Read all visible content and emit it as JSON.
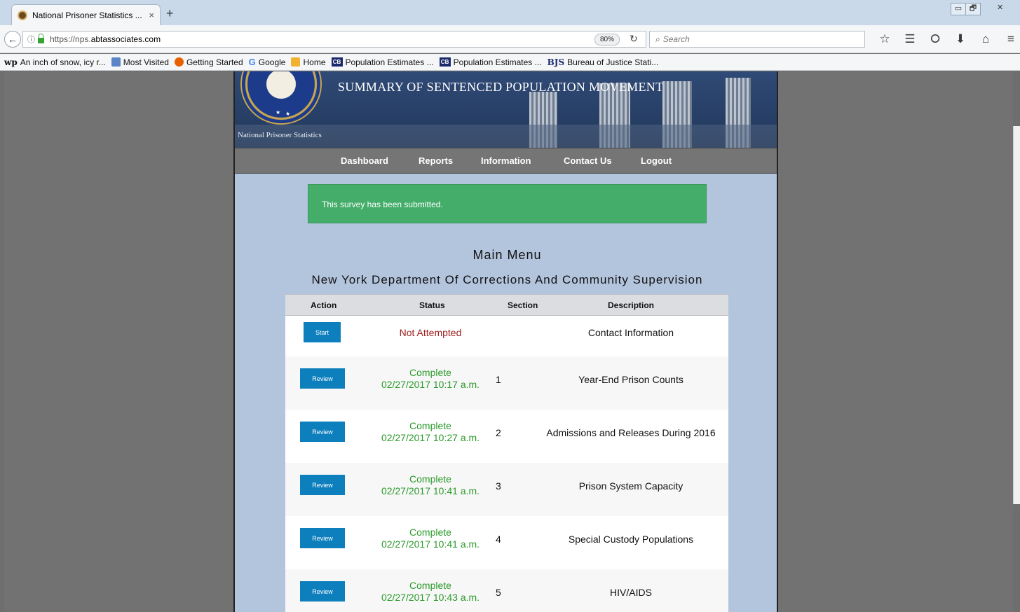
{
  "browser": {
    "tab_title": "National Prisoner Statistics ...",
    "tab_close": "×",
    "new_tab": "+",
    "url_prefix": "https://nps.",
    "url_host": "abtassociates.com",
    "zoom": "80%",
    "search_placeholder": "Search",
    "window_controls": [
      "▭",
      "🗗",
      "✕"
    ],
    "bookmarks": [
      {
        "icon": "washington-post-icon",
        "glyph": "wp",
        "label": "An inch of snow, icy r..."
      },
      {
        "icon": "most-visited-icon",
        "glyph": "",
        "label": "Most Visited"
      },
      {
        "icon": "firefox-icon",
        "glyph": "",
        "label": "Getting Started"
      },
      {
        "icon": "google-icon",
        "glyph": "G",
        "label": "Google"
      },
      {
        "icon": "home-icon",
        "glyph": "",
        "label": "Home"
      },
      {
        "icon": "census-icon",
        "glyph": "CB",
        "label": "Population Estimates ..."
      },
      {
        "icon": "census-icon",
        "glyph": "CB",
        "label": "Population Estimates ..."
      },
      {
        "icon": "bjs-icon",
        "glyph": "BJS",
        "label": "Bureau of Justice Stati..."
      }
    ]
  },
  "banner": {
    "title": "SUMMARY OF SENTENCED POPULATION MOVEMENT",
    "subtitle": "National Prisoner Statistics"
  },
  "nav": {
    "dashboard": "Dashboard",
    "reports": "Reports",
    "information": "Information",
    "contact": "Contact Us",
    "logout": "Logout"
  },
  "alert": {
    "message": "This survey has been submitted."
  },
  "main": {
    "heading": "Main Menu",
    "organization": "New York Department Of Corrections And Community Supervision"
  },
  "table": {
    "headers": {
      "action": "Action",
      "status": "Status",
      "section": "Section",
      "description": "Description"
    },
    "rows": [
      {
        "action": "Start",
        "status": "Not Attempted",
        "date": "",
        "section": "",
        "description": "Contact Information"
      },
      {
        "action": "Review",
        "status": "Complete",
        "date": "02/27/2017 10:17 a.m.",
        "section": "1",
        "description": "Year-End Prison Counts"
      },
      {
        "action": "Review",
        "status": "Complete",
        "date": "02/27/2017 10:27 a.m.",
        "section": "2",
        "description": "Admissions and Releases During 2016"
      },
      {
        "action": "Review",
        "status": "Complete",
        "date": "02/27/2017 10:41 a.m.",
        "section": "3",
        "description": "Prison System Capacity"
      },
      {
        "action": "Review",
        "status": "Complete",
        "date": "02/27/2017 10:41 a.m.",
        "section": "4",
        "description": "Special Custody Populations"
      },
      {
        "action": "Review",
        "status": "Complete",
        "date": "02/27/2017 10:43 a.m.",
        "section": "5",
        "description": "HIV/AIDS"
      }
    ]
  },
  "colors": {
    "alert_green": "#45ad6a",
    "button_blue": "#0d7fbd",
    "status_incomplete": "#9d1b1b",
    "status_complete": "#2a9a2a",
    "page_background": "#b3c4dd"
  }
}
